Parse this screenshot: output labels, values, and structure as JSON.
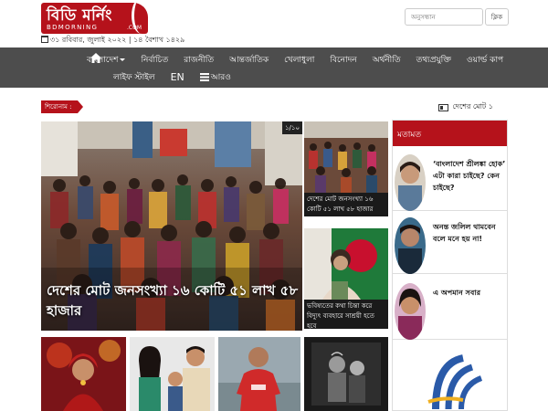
{
  "header": {
    "logo_text": "বিডি মর্নিং",
    "logo_subtext": "BDMORNING",
    "logo_com": ".COM",
    "date": "৩১ রবিবার, জুলাই ২০২২ | ১৪ বৈশাখ ১৪২৯",
    "search_placeholder": "অনুসন্ধান",
    "search_button": "ক্লিক"
  },
  "nav": {
    "row1": [
      "বাংলাদেশ",
      "নির্বাচিত",
      "রাজনীতি",
      "আন্তর্জাতিক",
      "খেলাধুলা",
      "বিনোদন",
      "অর্থনীতি",
      "তথ্যপ্রযুক্তি",
      "ওয়ার্ল্ড কাপ"
    ],
    "row2": [
      "লাইফ স্টাইল",
      "EN",
      "আরও"
    ]
  },
  "ticker": {
    "label": "শিরোনাম :",
    "text": "দেশের মোট ১"
  },
  "feature": {
    "counter": "১/১০",
    "title": "দেশের মোট জনসংখ্যা ১৬ কোটি ৫১ লাখ ৫৮ হাজার"
  },
  "middle": [
    {
      "caption": "দেশের মোট জনসংখ্যা ১৬ কোটি ৫১ লাখ ৫৮ হাজার"
    },
    {
      "caption": "ভবিষ্যতের কথা চিন্তা করে বিদ্যুৎ ব্যবহারে সাশ্রয়ী হতে হবে"
    }
  ],
  "opinion": {
    "heading": "মতামত",
    "items": [
      {
        "title": "‘বাংলাদেশ শ্রীলঙ্কা হোক’ এটা কারা চাইছে? কেন চাইছে?"
      },
      {
        "title": "অনন্ত জলিল থামবেন বলে মনে হয় না!"
      },
      {
        "title": "এ অপমান সবার"
      }
    ]
  },
  "colors": {
    "brand": "#b5121b",
    "nav_bg": "#4d4d4d"
  }
}
